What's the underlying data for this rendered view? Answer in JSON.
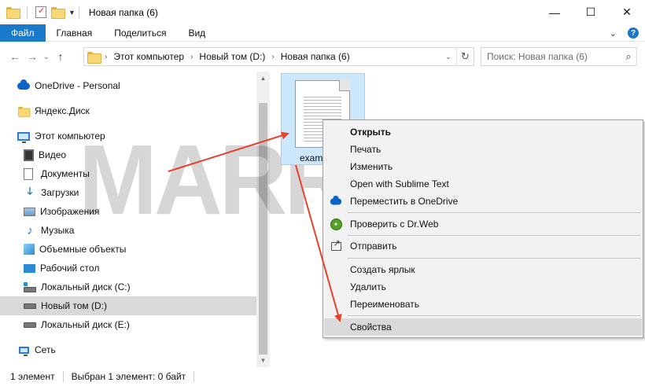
{
  "window": {
    "title": "Новая папка (6)",
    "minimize": "—",
    "maximize": "☐",
    "close": "✕"
  },
  "ribbon": {
    "tabs": [
      "Файл",
      "Главная",
      "Поделиться",
      "Вид"
    ],
    "accent": "#1979ca",
    "help": "?"
  },
  "nav": {
    "back": "←",
    "forward": "→",
    "recent": "⌄",
    "up": "↑",
    "breadcrumb": [
      "Этот компьютер",
      "Новый том (D:)",
      "Новая папка (6)"
    ],
    "refresh": "↻",
    "search_placeholder": "Поиск: Новая папка (6)"
  },
  "sidebar": {
    "items": [
      {
        "label": "OneDrive - Personal",
        "icon": "onedrive-icon"
      },
      {
        "label": "Яндекс.Диск",
        "icon": "yandex-disk-icon"
      },
      {
        "label": "Этот компьютер",
        "icon": "this-pc-icon"
      },
      {
        "label": "Видео",
        "icon": "video-icon"
      },
      {
        "label": "Документы",
        "icon": "documents-icon"
      },
      {
        "label": "Загрузки",
        "icon": "downloads-icon"
      },
      {
        "label": "Изображения",
        "icon": "pictures-icon"
      },
      {
        "label": "Музыка",
        "icon": "music-icon"
      },
      {
        "label": "Объемные объекты",
        "icon": "3d-objects-icon"
      },
      {
        "label": "Рабочий стол",
        "icon": "desktop-icon"
      },
      {
        "label": "Локальный диск (C:)",
        "icon": "drive-c-icon"
      },
      {
        "label": "Новый том (D:)",
        "icon": "drive-d-icon",
        "selected": true
      },
      {
        "label": "Локальный диск (E:)",
        "icon": "drive-e-icon"
      },
      {
        "label": "Сеть",
        "icon": "network-icon"
      }
    ],
    "selected_color": "#d9d9d9"
  },
  "file": {
    "name": "exam"
  },
  "context_menu": {
    "items": [
      {
        "label": "Открыть",
        "bold": true
      },
      {
        "label": "Печать"
      },
      {
        "label": "Изменить"
      },
      {
        "label": "Open with Sublime Text"
      },
      {
        "label": "Переместить в OneDrive",
        "icon": "onedrive-icon"
      },
      {
        "label": "Проверить с Dr.Web",
        "icon": "drweb-icon"
      },
      {
        "label": "Отправить",
        "icon": "send-to-icon"
      },
      {
        "label": "Создать ярлык"
      },
      {
        "label": "Удалить"
      },
      {
        "label": "Переименовать"
      },
      {
        "label": "Свойства",
        "hovered": true
      }
    ]
  },
  "watermark": "MARRIX.RU",
  "status": {
    "count": "1 элемент",
    "selection": "Выбран 1 элемент: 0 байт"
  },
  "colors": {
    "selection_tile": "#cce8ff",
    "arrow": "#e8412e"
  }
}
